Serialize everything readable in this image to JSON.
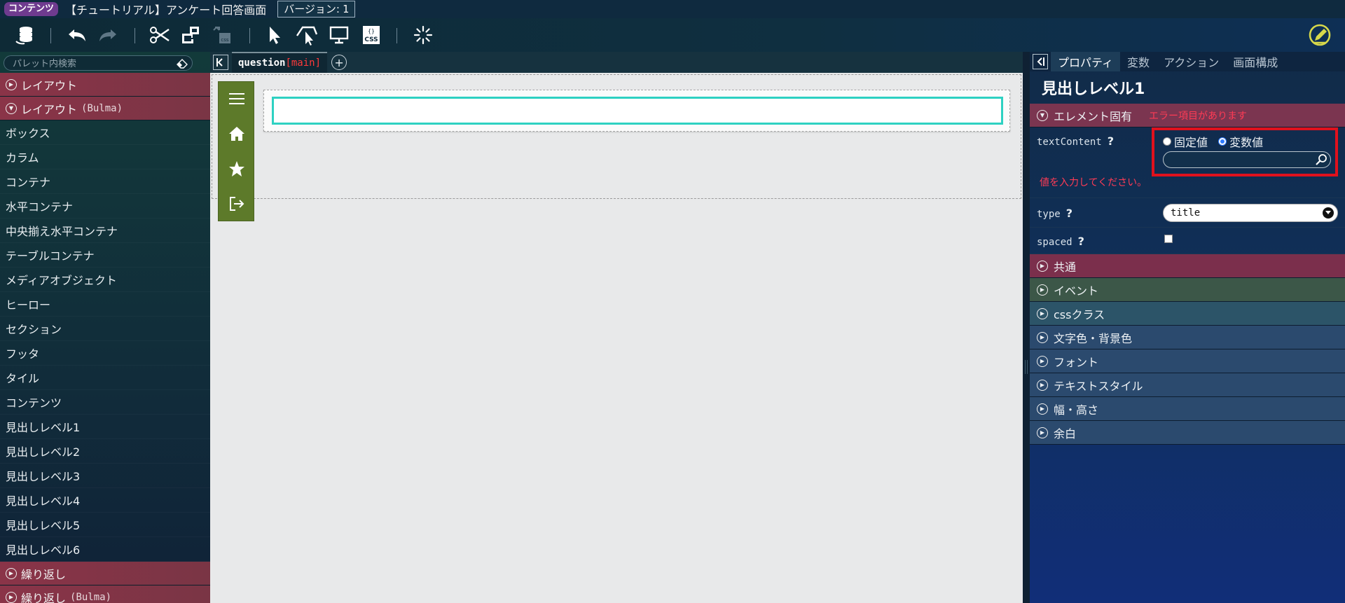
{
  "titlebar": {
    "badge": "コンテンツ",
    "title": "【チュートリアル】アンケート回答画面",
    "version_label": "バージョン:",
    "version_value": "1"
  },
  "toolbar": {
    "icons": [
      "database-icon",
      "undo-icon",
      "redo-icon",
      "cut-icon",
      "copy-structure-icon",
      "paste-icon",
      "select-pointer-icon",
      "parent-select-icon",
      "preview-monitor-icon",
      "css-icon",
      "loading-spinner-icon",
      "edit-pencil-icon"
    ]
  },
  "palette": {
    "search_placeholder": "パレット内検索",
    "categories": [
      {
        "label": "レイアウト",
        "sub": "",
        "open": false
      },
      {
        "label": "レイアウト",
        "sub": "(Bulma)",
        "open": true
      }
    ],
    "items": [
      "ボックス",
      "カラム",
      "コンテナ",
      "水平コンテナ",
      "中央揃え水平コンテナ",
      "テーブルコンテナ",
      "メディアオブジェクト",
      "ヒーロー",
      "セクション",
      "フッタ",
      "タイル",
      "コンテンツ",
      "見出しレベル1",
      "見出しレベル2",
      "見出しレベル3",
      "見出しレベル4",
      "見出しレベル5",
      "見出しレベル6"
    ],
    "bottom_categories": [
      {
        "label": "繰り返し",
        "sub": ""
      },
      {
        "label": "繰り返し",
        "sub": "(Bulma)"
      }
    ]
  },
  "canvas": {
    "tab_name": "question",
    "tab_suffix": "[main]"
  },
  "props": {
    "tabs": [
      "プロパティ",
      "変数",
      "アクション",
      "画面構成"
    ],
    "active_tab": "プロパティ",
    "title": "見出しレベル1",
    "element_section": "エレメント固有",
    "element_error": "エラー項目があります",
    "textContent": {
      "label": "textContent",
      "radio_fixed": "固定値",
      "radio_variable": "変数値",
      "selected": "変数値",
      "value": "",
      "error": "値を入力してください。"
    },
    "type": {
      "label": "type",
      "value": "title"
    },
    "spaced": {
      "label": "spaced",
      "checked": false
    },
    "sections": [
      {
        "label": "共通",
        "style": "dpink"
      },
      {
        "label": "イベント",
        "style": "olive"
      },
      {
        "label": "cssクラス",
        "style": "teal"
      },
      {
        "label": "文字色・背景色",
        "style": "slate"
      },
      {
        "label": "フォント",
        "style": "slate"
      },
      {
        "label": "テキストスタイル",
        "style": "slate"
      },
      {
        "label": "幅・高さ",
        "style": "slate"
      },
      {
        "label": "余白",
        "style": "slate"
      }
    ],
    "help_glyph": "?"
  },
  "colors": {
    "accent_error": "#e0111d",
    "selection": "#2ed1c2",
    "menu_green": "#5d7a2a",
    "category_pink": "#8a3448"
  }
}
